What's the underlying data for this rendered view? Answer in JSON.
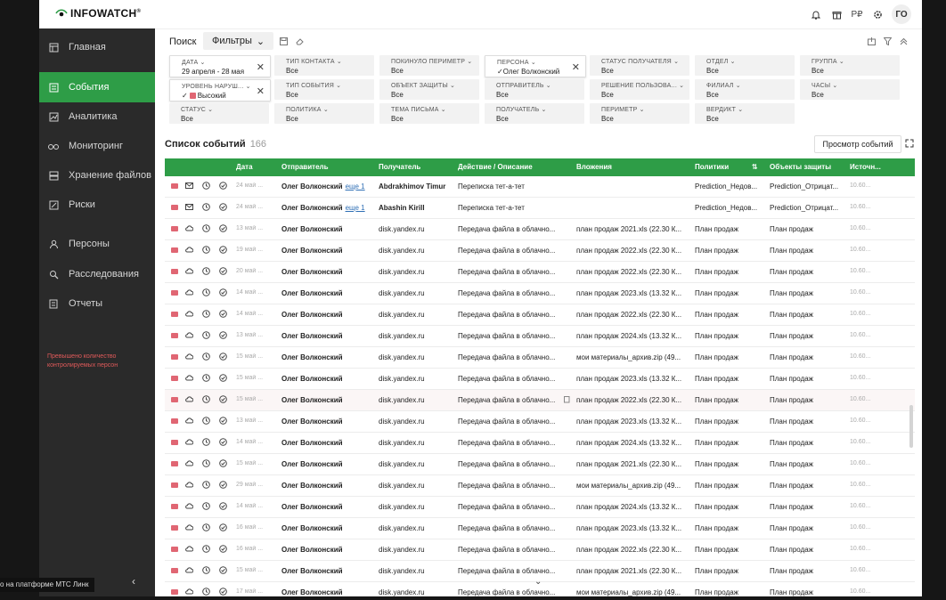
{
  "app": {
    "logo_text": "INFOWATCH",
    "logo_mark": "®"
  },
  "header": {
    "avatar": "ГО",
    "icons": [
      "bell-icon",
      "gift-icon",
      "language-icon",
      "settings-icon"
    ],
    "lang_label": "Р₽"
  },
  "sidebar": {
    "items": [
      {
        "label": "Главная",
        "icon": "home-icon"
      },
      {
        "label": "События",
        "icon": "events-icon",
        "active": true
      },
      {
        "label": "Аналитика",
        "icon": "analytics-icon"
      },
      {
        "label": "Мониторинг",
        "icon": "monitoring-icon"
      },
      {
        "label": "Хранение файлов",
        "icon": "storage-icon"
      },
      {
        "label": "Риски",
        "icon": "risks-icon"
      },
      {
        "label": "Персоны",
        "icon": "persons-icon"
      },
      {
        "label": "Расследования",
        "icon": "investigations-icon"
      },
      {
        "label": "Отчеты",
        "icon": "reports-icon"
      }
    ],
    "warning": "Превышено количество контролируемых персон",
    "collapse_glyph": "‹",
    "platform_label": "о на платформе МТС Линк"
  },
  "filterbar": {
    "search_tab": "Поиск",
    "filters_tab": "Фильтры",
    "filters_chevron": "⌄"
  },
  "filters": [
    {
      "label": "ДАТА ⌄",
      "value": "29 апреля - 28 мая",
      "selected": true,
      "clear": "✕"
    },
    {
      "label": "ТИП КОНТАКТА ⌄",
      "value": "Все"
    },
    {
      "label": "ПОКИНУЛО ПЕРИМЕТР ⌄",
      "value": "Все"
    },
    {
      "label": "ПЕРСОНА ⌄",
      "value": "✓Олег Волконский",
      "selected": true,
      "clear": "✕"
    },
    {
      "label": "СТАТУС ПОЛУЧАТЕЛЯ ⌄",
      "value": "Все"
    },
    {
      "label": "ОТДЕЛ ⌄",
      "value": "Все"
    },
    {
      "label": "ГРУППА ⌄",
      "value": "Все"
    },
    {
      "label": "УРОВЕНЬ НАРУШ... ⌄",
      "value": "Высокий",
      "value_prefix": "✓",
      "selected": true,
      "clear": "✕"
    },
    {
      "label": "ТИП СОБЫТИЯ ⌄",
      "value": "Все"
    },
    {
      "label": "ОБЪЕКТ ЗАЩИТЫ ⌄",
      "value": "Все"
    },
    {
      "label": "ОТПРАВИТЕЛЬ ⌄",
      "value": "Все"
    },
    {
      "label": "РЕШЕНИЕ ПОЛЬЗОВА... ⌄",
      "value": "Все"
    },
    {
      "label": "ФИЛИАЛ ⌄",
      "value": "Все"
    },
    {
      "label": "ЧАСЫ ⌄",
      "value": "Все"
    },
    {
      "label": "СТАТУС ⌄",
      "value": "Все"
    },
    {
      "label": "ПОЛИТИКА ⌄",
      "value": "Все"
    },
    {
      "label": "ТЕМА ПИСЬМА ⌄",
      "value": "Все"
    },
    {
      "label": "ПОЛУЧАТЕЛЬ ⌄",
      "value": "Все"
    },
    {
      "label": "ПЕРИМЕТР ⌄",
      "value": "Все"
    },
    {
      "label": "ВЕРДИКТ ⌄",
      "value": "Все"
    }
  ],
  "list": {
    "title": "Список событий",
    "count": "166",
    "view_button": "Просмотр событий"
  },
  "table": {
    "columns": [
      "Дата",
      "Отправитель",
      "Получатель",
      "Действие / Описание",
      "Вложения",
      "Политики",
      "Объекты защиты",
      "Источн..."
    ],
    "rows": [
      {
        "type": "mail",
        "date": "24 май ...",
        "sender": "Олег Волконский",
        "more": "еще 1",
        "recipient": "Abdrakhimov Timur",
        "action": "Переписка тет-а-тет",
        "attach": "",
        "policy": "Prediction_Недов...",
        "object": "Prediction_Отрицат...",
        "source": "10.60..."
      },
      {
        "type": "mail",
        "date": "24 май ...",
        "sender": "Олег Волконский",
        "more": "еще 1",
        "recipient": "Abashin Kirill",
        "action": "Переписка тет-а-тет",
        "attach": "",
        "policy": "Prediction_Недов...",
        "object": "Prediction_Отрицат...",
        "source": "10.60..."
      },
      {
        "type": "cloud",
        "date": "13 май ...",
        "sender": "Олег Волконский",
        "recipient": "disk.yandex.ru",
        "action": "Передача файла в облачно...",
        "attach": "план продаж 2021.xls (22.30 К...",
        "policy": "План продаж",
        "object": "План продаж",
        "source": "10.60..."
      },
      {
        "type": "cloud",
        "date": "19 май ...",
        "sender": "Олег Волконский",
        "recipient": "disk.yandex.ru",
        "action": "Передача файла в облачно...",
        "attach": "план продаж 2022.xls (22.30 К...",
        "policy": "План продаж",
        "object": "План продаж",
        "source": "10.60..."
      },
      {
        "type": "cloud",
        "date": "20 май ...",
        "sender": "Олег Волконский",
        "recipient": "disk.yandex.ru",
        "action": "Передача файла в облачно...",
        "attach": "план продаж 2022.xls (22.30 К...",
        "policy": "План продаж",
        "object": "План продаж",
        "source": "10.60..."
      },
      {
        "type": "cloud",
        "date": "14 май ...",
        "sender": "Олег Волконский",
        "recipient": "disk.yandex.ru",
        "action": "Передача файла в облачно...",
        "attach": "план продаж 2023.xls (13.32 К...",
        "policy": "План продаж",
        "object": "План продаж",
        "source": "10.60..."
      },
      {
        "type": "cloud",
        "date": "14 май ...",
        "sender": "Олег Волконский",
        "recipient": "disk.yandex.ru",
        "action": "Передача файла в облачно...",
        "attach": "план продаж 2022.xls (22.30 К...",
        "policy": "План продаж",
        "object": "План продаж",
        "source": "10.60..."
      },
      {
        "type": "cloud",
        "date": "13 май ...",
        "sender": "Олег Волконский",
        "recipient": "disk.yandex.ru",
        "action": "Передача файла в облачно...",
        "attach": "план продаж 2024.xls (13.32 К...",
        "policy": "План продаж",
        "object": "План продаж",
        "source": "10.60..."
      },
      {
        "type": "cloud",
        "date": "15 май ...",
        "sender": "Олег Волконский",
        "recipient": "disk.yandex.ru",
        "action": "Передача файла в облачно...",
        "attach": "мои материалы_архив.zip (49...",
        "policy": "План продаж",
        "object": "План продаж",
        "source": "10.60..."
      },
      {
        "type": "cloud",
        "date": "15 май ...",
        "sender": "Олег Волконский",
        "recipient": "disk.yandex.ru",
        "action": "Передача файла в облачно...",
        "attach": "план продаж 2023.xls (13.32 К...",
        "policy": "План продаж",
        "object": "План продаж",
        "source": "10.60..."
      },
      {
        "type": "cloud",
        "date": "15 май ...",
        "sender": "Олег Волконский",
        "recipient": "disk.yandex.ru",
        "action": "Передача файла в облачно...",
        "attach": "план продаж 2022.xls (22.30 К...",
        "policy": "План продаж",
        "object": "План продаж",
        "source": "10.60...",
        "highlight": true
      },
      {
        "type": "cloud",
        "date": "13 май ...",
        "sender": "Олег Волконский",
        "recipient": "disk.yandex.ru",
        "action": "Передача файла в облачно...",
        "attach": "план продаж 2023.xls (13.32 К...",
        "policy": "План продаж",
        "object": "План продаж",
        "source": "10.60..."
      },
      {
        "type": "cloud",
        "date": "14 май ...",
        "sender": "Олег Волконский",
        "recipient": "disk.yandex.ru",
        "action": "Передача файла в облачно...",
        "attach": "план продаж 2024.xls (13.32 К...",
        "policy": "План продаж",
        "object": "План продаж",
        "source": "10.60..."
      },
      {
        "type": "cloud",
        "date": "15 май ...",
        "sender": "Олег Волконский",
        "recipient": "disk.yandex.ru",
        "action": "Передача файла в облачно...",
        "attach": "план продаж 2021.xls (22.30 К...",
        "policy": "План продаж",
        "object": "План продаж",
        "source": "10.60..."
      },
      {
        "type": "cloud",
        "date": "29 май ...",
        "sender": "Олег Волконский",
        "recipient": "disk.yandex.ru",
        "action": "Передача файла в облачно...",
        "attach": "мои материалы_архив.zip (49...",
        "policy": "План продаж",
        "object": "План продаж",
        "source": "10.60..."
      },
      {
        "type": "cloud",
        "date": "14 май ...",
        "sender": "Олег Волконский",
        "recipient": "disk.yandex.ru",
        "action": "Передача файла в облачно...",
        "attach": "план продаж 2024.xls (13.32 К...",
        "policy": "План продаж",
        "object": "План продаж",
        "source": "10.60..."
      },
      {
        "type": "cloud",
        "date": "16 май ...",
        "sender": "Олег Волконский",
        "recipient": "disk.yandex.ru",
        "action": "Передача файла в облачно...",
        "attach": "план продаж 2023.xls (13.32 К...",
        "policy": "План продаж",
        "object": "План продаж",
        "source": "10.60..."
      },
      {
        "type": "cloud",
        "date": "16 май ...",
        "sender": "Олег Волконский",
        "recipient": "disk.yandex.ru",
        "action": "Передача файла в облачно...",
        "attach": "план продаж 2022.xls (22.30 К...",
        "policy": "План продаж",
        "object": "План продаж",
        "source": "10.60..."
      },
      {
        "type": "cloud",
        "date": "15 май ...",
        "sender": "Олег Волконский",
        "recipient": "disk.yandex.ru",
        "action": "Передача файла в облачно...",
        "attach": "план продаж 2021.xls (22.30 К...",
        "policy": "План продаж",
        "object": "План продаж",
        "source": "10.60..."
      },
      {
        "type": "cloud",
        "date": "17 май ...",
        "sender": "Олег Волконский",
        "recipient": "disk.yandex.ru",
        "action": "Передача файла в облачно...",
        "attach": "мои материалы_архив.zip (49...",
        "policy": "План продаж",
        "object": "План продаж",
        "source": "10.60..."
      }
    ]
  },
  "colors": {
    "accent_green": "#2e9d47",
    "sidebar_bg": "#2a2a2a",
    "flag_red": "#e06673",
    "link_blue": "#2f6fb5",
    "warning_red": "#e05a5a"
  },
  "more_glyph": "⌄"
}
